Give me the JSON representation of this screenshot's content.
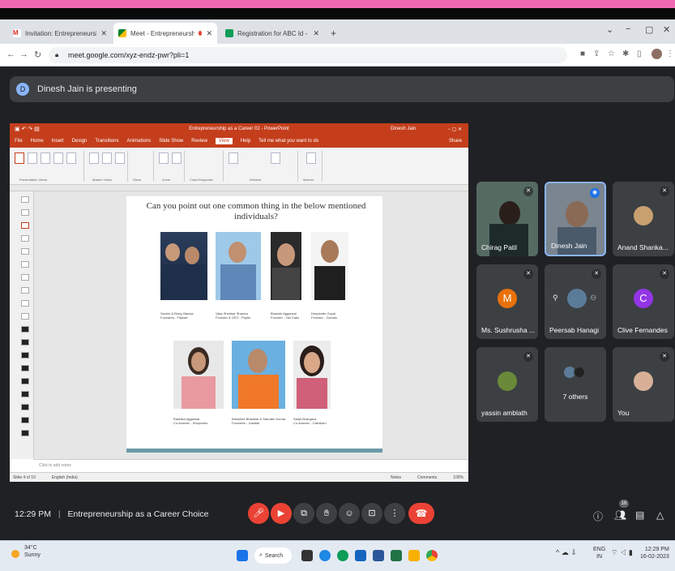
{
  "browser": {
    "tabs": [
      {
        "title": "Invitation: Entrepreneurship as a",
        "icon": "gmail-icon"
      },
      {
        "title": "Meet - Entrepreneurship as",
        "icon": "meet-icon"
      },
      {
        "title": "Registration for ABC Id - Google",
        "icon": "forms-icon"
      }
    ],
    "new_tab": "+",
    "window_controls": [
      "⌄",
      "−",
      "▢",
      "✕"
    ],
    "url": "meet.google.com/xyz-endz-pwr?pli=1"
  },
  "meet": {
    "presenting_banner": "Dinesh Jain is presenting",
    "presenter_initial": "D",
    "participants": [
      {
        "name": "Chirag Patil"
      },
      {
        "name": "Dinesh Jain"
      },
      {
        "name": "Anand Shanka..."
      },
      {
        "name": "Ms. Sushrusha ...",
        "initial": "M"
      },
      {
        "name": "Peersab Hanagi"
      },
      {
        "name": "Clive Fernandes",
        "initial": "C"
      },
      {
        "name": "yassin amblath"
      },
      {
        "name": "7 others"
      },
      {
        "name": "You"
      }
    ],
    "time": "12:29 PM",
    "separator": "|",
    "meeting_title": "Entrepreneurship as a Career Choice",
    "people_count": "16",
    "colors": {
      "red": "#ea4335",
      "tile": "#3c4043",
      "bg": "#202124"
    }
  },
  "ppt": {
    "window_title": "Entrepreneurship as a Career 02 - PowerPoint",
    "user": "Dinesh Jain",
    "menu": [
      "File",
      "Home",
      "Insert",
      "Design",
      "Transitions",
      "Animations",
      "Slide Show",
      "Review",
      "View",
      "Help",
      "Tell me what you want to do"
    ],
    "active_menu": "View",
    "share": "Share",
    "ribbon_groups": [
      "Presentation Views",
      "Master Views",
      "Show",
      "Zoom",
      "Color/Grayscale",
      "Window",
      "Macros"
    ],
    "notes_placeholder": "Click to add notes",
    "status": {
      "slide": "Slide 4 of 10",
      "language": "English (India)",
      "notes": "Notes",
      "comments": "Comments",
      "zoom": "100%"
    }
  },
  "slide": {
    "question_line1": "Can you point out one common thing in the below mentioned",
    "question_line2": "individuals?",
    "people": [
      {
        "name": "Sachin & Binny Bansal",
        "role": "Founders - Flipkart"
      },
      {
        "name": "Vijay Shekhar Sharma",
        "role": "Founder & CEO - Paytm"
      },
      {
        "name": "Bhavish Aggarwal",
        "role": "Founder - Ola Cabs"
      },
      {
        "name": "Deepinder Goyal",
        "role": "Founder - Zomato"
      },
      {
        "name": "Radhika Aggarwal",
        "role": "Co-founder - Shopclues"
      },
      {
        "name": "Abhishek Bhalekar & Saurabh Kumar",
        "role": "Founders - Justdial"
      },
      {
        "name": "Sanjit Bhargava",
        "role": "Co-founder - Cashkaro"
      }
    ]
  },
  "taskbar": {
    "temperature": "34°C",
    "weather": "Sunny",
    "search": "Search",
    "lang": "ENG",
    "region": "IN",
    "time": "12:29 PM",
    "date": "16-02-2023"
  }
}
